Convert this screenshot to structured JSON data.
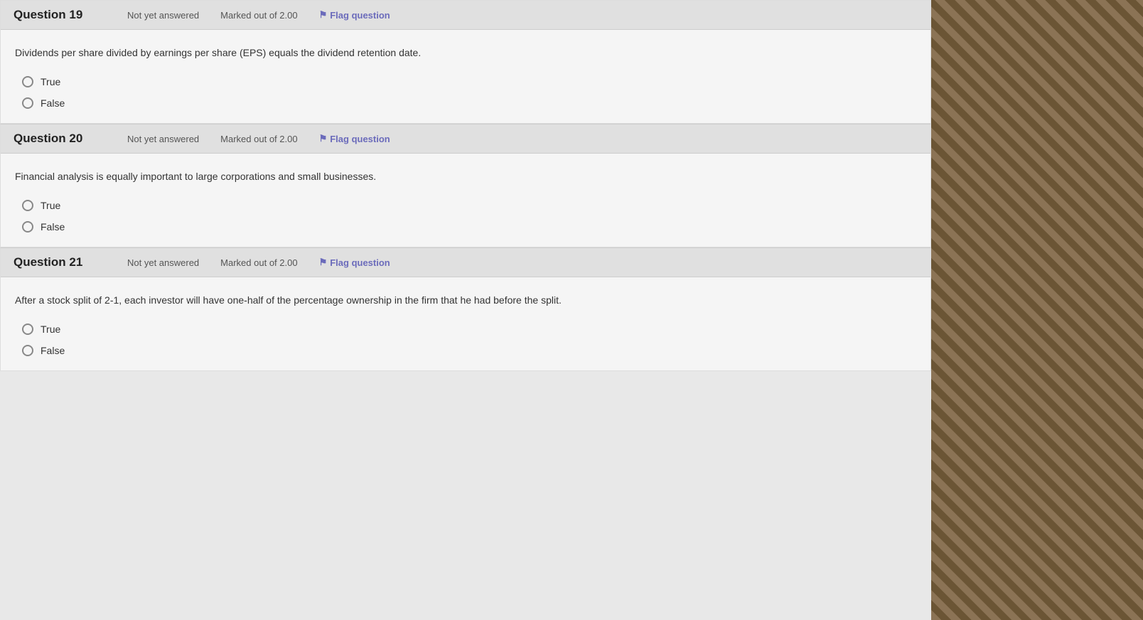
{
  "questions": [
    {
      "id": "q19",
      "title": "Question 19",
      "not_answered": "Not yet answered",
      "marked_out": "Marked out of 2.00",
      "flag_label": "Flag question",
      "question_text": "Dividends per share divided by earnings per share (EPS) equals the dividend retention date.",
      "options": [
        {
          "id": "q19_true",
          "label": "True",
          "name": "q19"
        },
        {
          "id": "q19_false",
          "label": "False",
          "name": "q19"
        }
      ]
    },
    {
      "id": "q20",
      "title": "Question 20",
      "not_answered": "Not yet answered",
      "marked_out": "Marked out of 2.00",
      "flag_label": "Flag question",
      "question_text": "Financial analysis is equally important to large corporations and small businesses.",
      "options": [
        {
          "id": "q20_true",
          "label": "True",
          "name": "q20"
        },
        {
          "id": "q20_false",
          "label": "False",
          "name": "q20"
        }
      ]
    },
    {
      "id": "q21",
      "title": "Question 21",
      "not_answered": "Not yet answered",
      "marked_out": "Marked out of 2.00",
      "flag_label": "Flag question",
      "question_text": "After a stock split of 2-1, each investor will have one-half of the percentage ownership in the firm that he had before the split.",
      "options": [
        {
          "id": "q21_true",
          "label": "True",
          "name": "q21"
        },
        {
          "id": "q21_false",
          "label": "False",
          "name": "q21"
        }
      ]
    }
  ]
}
